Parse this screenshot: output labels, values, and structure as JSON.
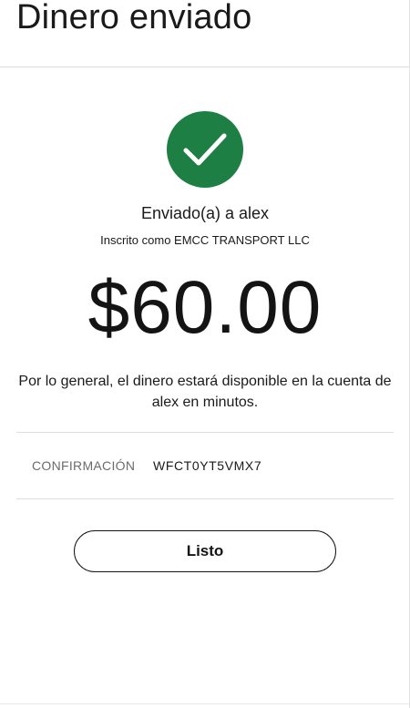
{
  "header": {
    "title": "Dinero enviado"
  },
  "confirmation": {
    "icon": "check-icon",
    "icon_color": "#1e7f44",
    "sent_to": "Enviado(a) a alex",
    "enrolled_as": "Inscrito como EMCC TRANSPORT LLC",
    "amount": "$60.00",
    "availability_line1": "Por lo general, el dinero estará disponible en la cuenta de",
    "availability_line2": "alex en minutos.",
    "code_label": "CONFIRMACIÓN",
    "code_value": "WFCT0YT5VMX7"
  },
  "actions": {
    "done_label": "Listo"
  }
}
